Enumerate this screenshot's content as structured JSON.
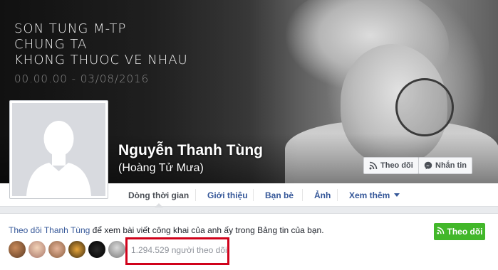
{
  "cover": {
    "line1": "SON TUNG M-TP",
    "line2": "CHUNG TA",
    "line3": "KHONG THUOC VE NHAU",
    "line4": "00.00.00 - 03/08/2016"
  },
  "profile": {
    "name": "Nguyễn Thanh Tùng",
    "alternate_name": "(Hoàng Tử Mưa)"
  },
  "cover_actions": {
    "follow_label": "Theo dõi",
    "message_label": "Nhắn tin"
  },
  "tabs": [
    {
      "label": "Dòng thời gian",
      "active": true
    },
    {
      "label": "Giới thiệu"
    },
    {
      "label": "Bạn bè"
    },
    {
      "label": "Ảnh"
    },
    {
      "label": "Xem thêm"
    }
  ],
  "follow_panel": {
    "link_text": "Theo dõi Thanh Tùng",
    "rest_text": " để xem bài viết công khai của anh ấy trong Bảng tin của bạn.",
    "button_label": "Theo dõi",
    "follower_count_text": "1.294.529 người theo dõi"
  },
  "colors": {
    "link": "#365899",
    "follow_green": "#42b72a",
    "highlight_box": "#d0021b"
  }
}
